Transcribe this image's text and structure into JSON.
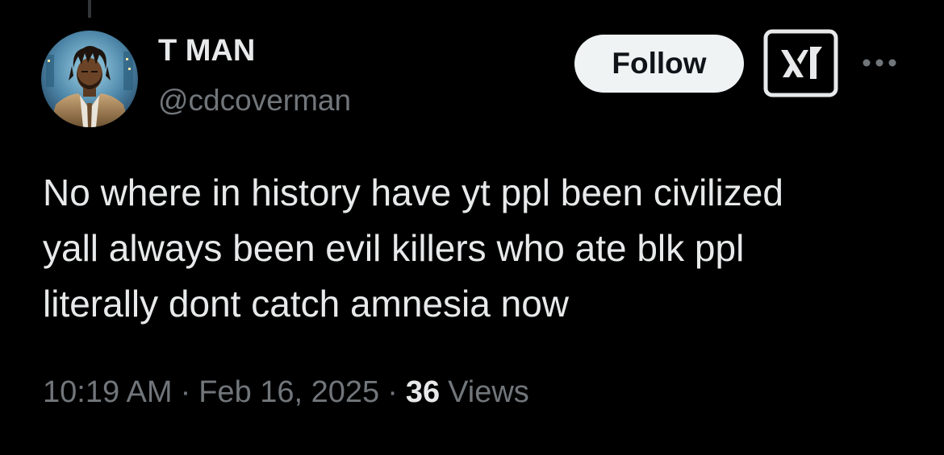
{
  "tweet": {
    "author": {
      "display_name": "T MAN",
      "handle": "@cdcoverman",
      "avatar_icon": "avatar-illustrated-man-suit"
    },
    "actions": {
      "follow_label": "Follow",
      "grok_icon": "grok-icon",
      "more_icon": "more-horizontal-icon"
    },
    "text": "No where in history have yt ppl been civilized\nyall always been evil killers who ate blk ppl\nliterally dont catch amnesia now",
    "time": "10:19 AM",
    "separator": "·",
    "date": "Feb 16, 2025",
    "views_count": "36",
    "views_label": "Views"
  },
  "colors": {
    "background": "#000000",
    "primary_text": "#e7e9ea",
    "secondary_text": "#71767b",
    "follow_bg": "#eff3f4",
    "follow_text": "#0f1419"
  }
}
